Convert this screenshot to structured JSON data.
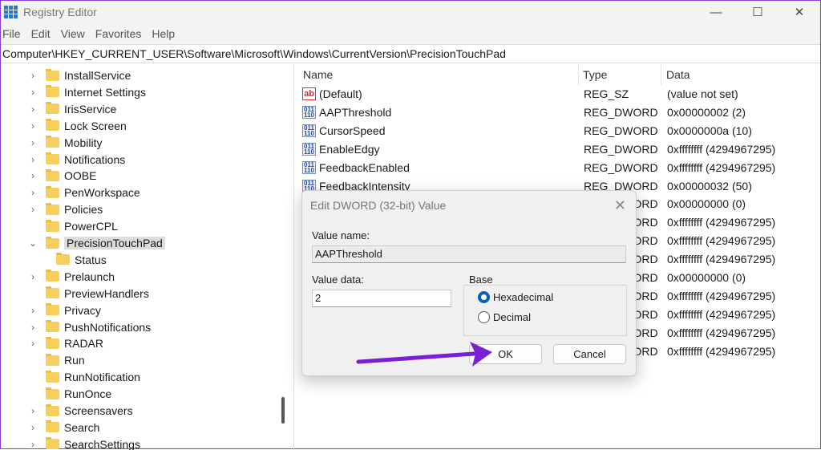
{
  "window": {
    "title": "Registry Editor",
    "minimize": "—",
    "maximize": "☐",
    "close": "✕"
  },
  "menu": [
    "File",
    "Edit",
    "View",
    "Favorites",
    "Help"
  ],
  "address": "Computer\\HKEY_CURRENT_USER\\Software\\Microsoft\\Windows\\CurrentVersion\\PrecisionTouchPad",
  "tree": [
    {
      "label": "InstallService",
      "expand": true
    },
    {
      "label": "Internet Settings",
      "expand": true
    },
    {
      "label": "IrisService",
      "expand": true
    },
    {
      "label": "Lock Screen",
      "expand": true
    },
    {
      "label": "Mobility",
      "expand": true
    },
    {
      "label": "Notifications",
      "expand": true
    },
    {
      "label": "OOBE",
      "expand": true
    },
    {
      "label": "PenWorkspace",
      "expand": true
    },
    {
      "label": "Policies",
      "expand": true
    },
    {
      "label": "PowerCPL",
      "expand": false
    },
    {
      "label": "PrecisionTouchPad",
      "expand": "open",
      "selected": true
    },
    {
      "label": "Status",
      "expand": false,
      "child": true
    },
    {
      "label": "Prelaunch",
      "expand": true
    },
    {
      "label": "PreviewHandlers",
      "expand": false
    },
    {
      "label": "Privacy",
      "expand": true
    },
    {
      "label": "PushNotifications",
      "expand": true
    },
    {
      "label": "RADAR",
      "expand": true
    },
    {
      "label": "Run",
      "expand": false
    },
    {
      "label": "RunNotification",
      "expand": false
    },
    {
      "label": "RunOnce",
      "expand": false
    },
    {
      "label": "Screensavers",
      "expand": true
    },
    {
      "label": "Search",
      "expand": true
    },
    {
      "label": "SearchSettings",
      "expand": true
    }
  ],
  "columns": {
    "name": "Name",
    "type": "Type",
    "data": "Data"
  },
  "values": [
    {
      "name": "(Default)",
      "type": "REG_SZ",
      "data": "(value not set)",
      "icon": "ab"
    },
    {
      "name": "AAPThreshold",
      "type": "REG_DWORD",
      "data": "0x00000002 (2)"
    },
    {
      "name": "CursorSpeed",
      "type": "REG_DWORD",
      "data": "0x0000000a (10)"
    },
    {
      "name": "EnableEdgy",
      "type": "REG_DWORD",
      "data": "0xffffffff (4294967295)"
    },
    {
      "name": "FeedbackEnabled",
      "type": "REG_DWORD",
      "data": "0xffffffff (4294967295)"
    },
    {
      "name": "FeedbackIntensity",
      "type": "REG_DWORD",
      "data": "0x00000032 (50)"
    },
    {
      "name": "",
      "type": "REG_DWORD",
      "data": "0x00000000 (0)"
    },
    {
      "name": "",
      "type": "REG_DWORD",
      "data": "0xffffffff (4294967295)"
    },
    {
      "name": "",
      "type": "REG_DWORD",
      "data": "0xffffffff (4294967295)"
    },
    {
      "name": "",
      "type": "REG_DWORD",
      "data": "0xffffffff (4294967295)"
    },
    {
      "name": "",
      "type": "REG_DWORD",
      "data": "0x00000000 (0)"
    },
    {
      "name": "",
      "type": "REG_DWORD",
      "data": "0xffffffff (4294967295)"
    },
    {
      "name": "",
      "type": "REG_DWORD",
      "data": "0xffffffff (4294967295)"
    },
    {
      "name": "",
      "type": "REG_DWORD",
      "data": "0xffffffff (4294967295)"
    },
    {
      "name": "",
      "type": "REG_DWORD",
      "data": "0xffffffff (4294967295)"
    }
  ],
  "dialog": {
    "title": "Edit DWORD (32-bit) Value",
    "value_name_label": "Value name:",
    "value_name": "AAPThreshold",
    "value_data_label": "Value data:",
    "value_data": "2",
    "base_label": "Base",
    "hex": "Hexadecimal",
    "dec": "Decimal",
    "base_selected": "Hexadecimal",
    "ok": "OK",
    "cancel": "Cancel"
  },
  "colors": {
    "arrow": "#7a1fd6",
    "radio": "#0a5fb8"
  }
}
